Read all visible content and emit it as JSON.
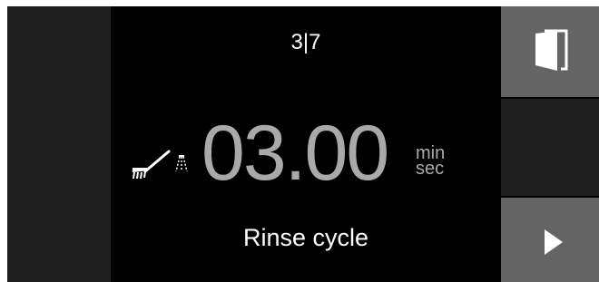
{
  "display": {
    "step_counter": "3|7",
    "time_value": "03.00",
    "time_unit_top": "min",
    "time_unit_bottom": "sec",
    "program_name": "Rinse cycle"
  },
  "icons": {
    "program_icon": "brush-spray-icon",
    "door_icon": "door-open-icon",
    "next_icon": "play-arrow-icon"
  },
  "colors": {
    "screen_background": "#000000",
    "side_panel": "#1e1e1e",
    "button_background": "#646464",
    "text_primary": "#ffffff",
    "text_timer": "#a9a9a9"
  }
}
